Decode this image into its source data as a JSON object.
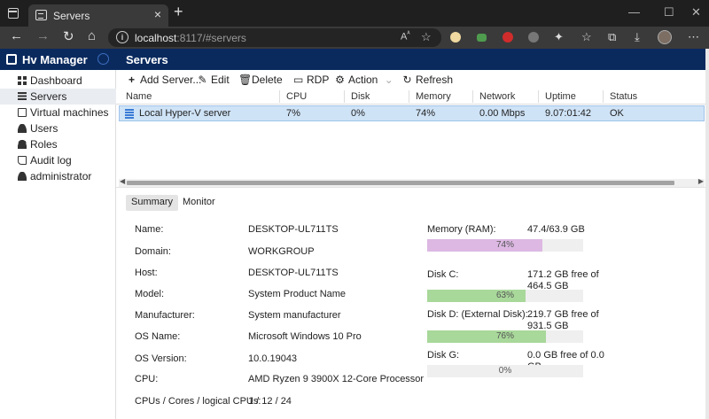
{
  "browser": {
    "tab_title": "Servers",
    "address_host": "localhost",
    "address_path": ":8117/#servers"
  },
  "app": {
    "name": "Hv Manager",
    "nav": [
      {
        "label": "Dashboard",
        "icon": "dashboard-icon"
      },
      {
        "label": "Servers",
        "icon": "servers-icon"
      },
      {
        "label": "Virtual machines",
        "icon": "virtual-machines-icon"
      },
      {
        "label": "Users",
        "icon": "user-icon"
      },
      {
        "label": "Roles",
        "icon": "roles-icon"
      },
      {
        "label": "Audit log",
        "icon": "audit-log-icon"
      },
      {
        "label": "administrator",
        "icon": "administrator-icon"
      }
    ],
    "active_nav": "Servers"
  },
  "page": {
    "title": "Servers",
    "actions": {
      "add": "Add Server...",
      "edit": "Edit",
      "delete": "Delete",
      "rdp": "RDP",
      "action": "Action",
      "refresh": "Refresh"
    },
    "columns": [
      "Name",
      "CPU",
      "Disk",
      "Memory",
      "Network",
      "Uptime",
      "Status"
    ],
    "rows": [
      {
        "name": "Local Hyper-V server",
        "cpu": "7%",
        "disk": "0%",
        "memory": "74%",
        "network": "0.00 Mbps",
        "uptime": "9.07:01:42",
        "status": "OK"
      }
    ]
  },
  "details": {
    "tabs": [
      "Summary",
      "Monitor"
    ],
    "active_tab": "Summary",
    "summary": [
      {
        "label": "Name:",
        "value": "DESKTOP-UL711TS"
      },
      {
        "label": "Domain:",
        "value": "WORKGROUP"
      },
      {
        "label": "Host:",
        "value": "DESKTOP-UL711TS"
      },
      {
        "label": "Model:",
        "value": "System Product Name"
      },
      {
        "label": "Manufacturer:",
        "value": "System manufacturer"
      },
      {
        "label": "OS Name:",
        "value": "Microsoft Windows 10 Pro"
      },
      {
        "label": "OS Version:",
        "value": "10.0.19043"
      },
      {
        "label": "CPU:",
        "value": "AMD Ryzen 9 3900X 12-Core Processor"
      },
      {
        "label": "CPUs / Cores / logical CPUs:",
        "value": "1 / 12 / 24"
      }
    ],
    "resources": [
      {
        "label": "Memory (RAM):",
        "value": "47.4/63.9 GB",
        "percent": 74,
        "percent_label": "74%",
        "color": "#dcb8e3"
      },
      {
        "label": "Disk C:",
        "value": "171.2 GB free of 464.5 GB",
        "percent": 63,
        "percent_label": "63%",
        "color": "#a8d89a"
      },
      {
        "label": "Disk D: (External Disk):",
        "value": "219.7 GB free of 931.5 GB",
        "percent": 76,
        "percent_label": "76%",
        "color": "#a8d89a"
      },
      {
        "label": "Disk G:",
        "value": "0.0 GB free of 0.0 GB",
        "percent": 0,
        "percent_label": "0%",
        "color": "#a8d89a"
      }
    ]
  }
}
